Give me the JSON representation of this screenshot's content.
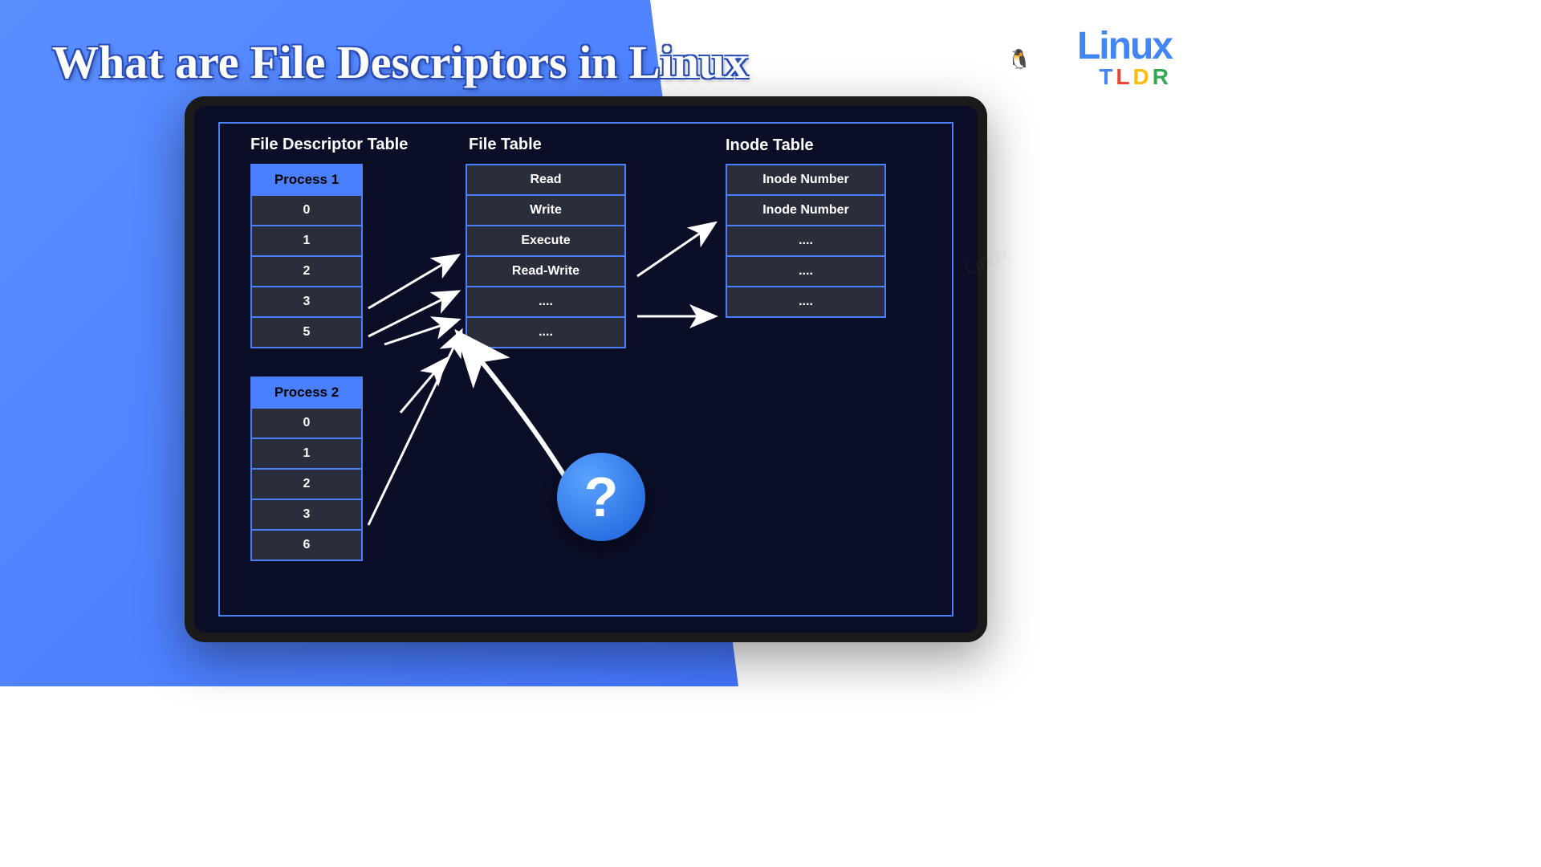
{
  "title": "What are File Descriptors in Linux",
  "logo": {
    "main": "Linux",
    "sub": "TLDR"
  },
  "diagram": {
    "fd_table": {
      "title": "File Descriptor Table",
      "process1": {
        "header": "Process 1",
        "rows": [
          "0",
          "1",
          "2",
          "3",
          "5"
        ]
      },
      "process2": {
        "header": "Process 2",
        "rows": [
          "0",
          "1",
          "2",
          "3",
          "6"
        ]
      }
    },
    "file_table": {
      "title": "File Table",
      "rows": [
        "Read",
        "Write",
        "Execute",
        "Read-Write",
        "....",
        "...."
      ]
    },
    "inode_table": {
      "title": "Inode Table",
      "rows": [
        "Inode Number",
        "Inode Number",
        "....",
        "....",
        "...."
      ]
    }
  },
  "question_symbol": "?"
}
